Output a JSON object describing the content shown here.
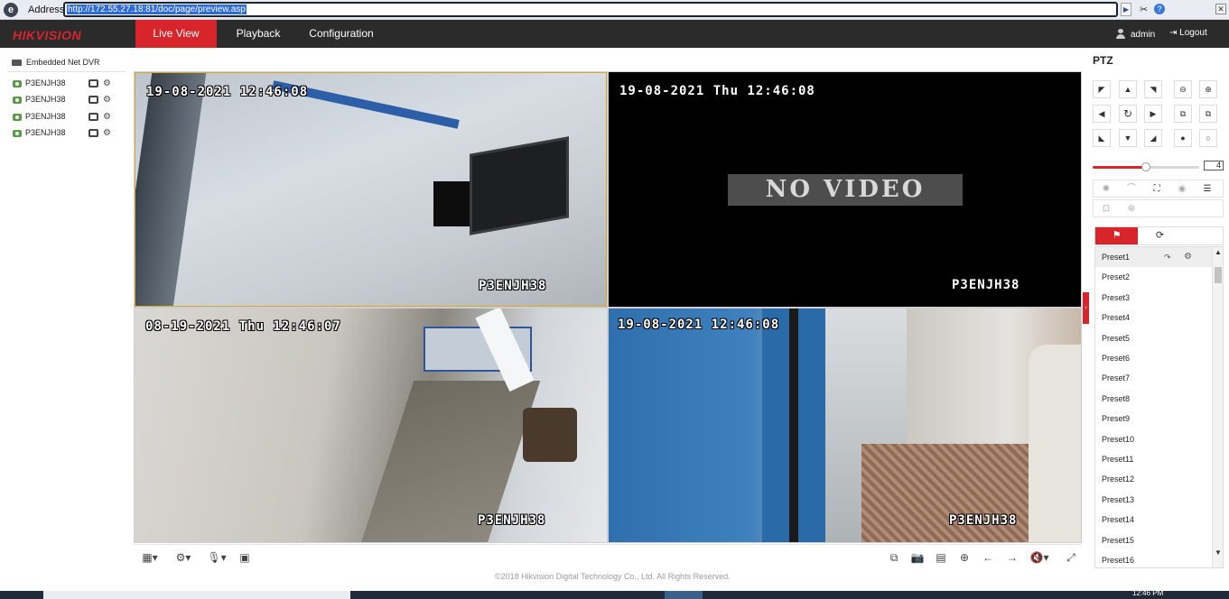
{
  "browser": {
    "address_label": "Address:",
    "url": "http://172.55.27.18:81/doc/page/preview.asp",
    "icons": [
      "ie-icon",
      "go-arrow-icon",
      "tools-icon",
      "help-icon",
      "close-icon"
    ]
  },
  "nav": {
    "logo": "HIKVISION",
    "tabs": [
      {
        "label": "Live View",
        "active": true
      },
      {
        "label": "Playback",
        "active": false
      },
      {
        "label": "Configuration",
        "active": false
      }
    ],
    "user": "admin",
    "logout": "Logout"
  },
  "tree": {
    "root": "Embedded Net DVR",
    "cameras": [
      {
        "label": "P3ENJH38"
      },
      {
        "label": "P3ENJH38"
      },
      {
        "label": "P3ENJH38"
      },
      {
        "label": "P3ENJH38"
      }
    ]
  },
  "panes": [
    {
      "timestamp": "19-08-2021 12:46:08",
      "name": "P3ENJH38",
      "selected": true
    },
    {
      "timestamp": "19-08-2021 Thu 12:46:08",
      "name": "P3ENJH38",
      "message": "NO VIDEO"
    },
    {
      "timestamp": "08-19-2021 Thu 12:46:07",
      "name": "P3ENJH38"
    },
    {
      "timestamp": "19-08-2021 12:46:08",
      "name": "P3ENJH38"
    }
  ],
  "ptz": {
    "title": "PTZ",
    "speed": "4",
    "speed_fraction": 0.5,
    "presets": [
      "Preset1",
      "Preset2",
      "Preset3",
      "Preset4",
      "Preset5",
      "Preset6",
      "Preset7",
      "Preset8",
      "Preset9",
      "Preset10",
      "Preset11",
      "Preset12",
      "Preset13",
      "Preset14",
      "Preset15",
      "Preset16"
    ]
  },
  "footer": "©2018 Hikvision Digital Technology Co., Ltd. All Rights Reserved.",
  "taskbar": {
    "clock": "12:46 PM"
  },
  "colors": {
    "accent": "#d7252b",
    "nav_bg": "#2b2b2b",
    "selected_border": "#d6a92a"
  }
}
